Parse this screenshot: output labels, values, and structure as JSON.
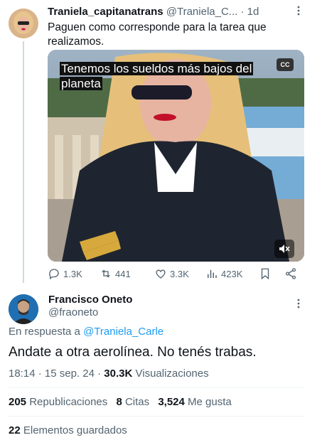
{
  "original_tweet": {
    "author_name": "Traniela_capitanatrans",
    "author_handle": "@Traniela_C...",
    "separator": "·",
    "time": "1d",
    "more_icon": "more-vertical-icon",
    "text": "Paguen como corresponde para la tarea que realizamos.",
    "video": {
      "caption": "Tenemos los sueldos más bajos del planeta",
      "cc_label": "CC",
      "mute_icon": "volume-muted-icon"
    },
    "actions": {
      "replies": "1.3K",
      "retweets": "441",
      "likes": "3.3K",
      "views": "423K"
    }
  },
  "reply_tweet": {
    "author_name": "Francisco Oneto",
    "author_handle": "@fraoneto",
    "more_icon": "more-vertical-icon",
    "reply_prefix": "En respuesta a",
    "reply_to": "@Traniela_Carle",
    "text": "Andate a otra aerolínea. No tenés trabas.",
    "time": "18:14",
    "date": "15 sep. 24",
    "views_count": "30.3K",
    "views_label": "Visualizaciones",
    "retweets_count": "205",
    "retweets_label": "Republicaciones",
    "quotes_count": "8",
    "quotes_label": "Citas",
    "likes_count": "3,524",
    "likes_label": "Me gusta",
    "bookmarks_count": "22",
    "bookmarks_label": "Elementos guardados"
  },
  "colors": {
    "link": "#1d9bf0",
    "secondary_text": "#536471",
    "primary_text": "#0f1419"
  }
}
